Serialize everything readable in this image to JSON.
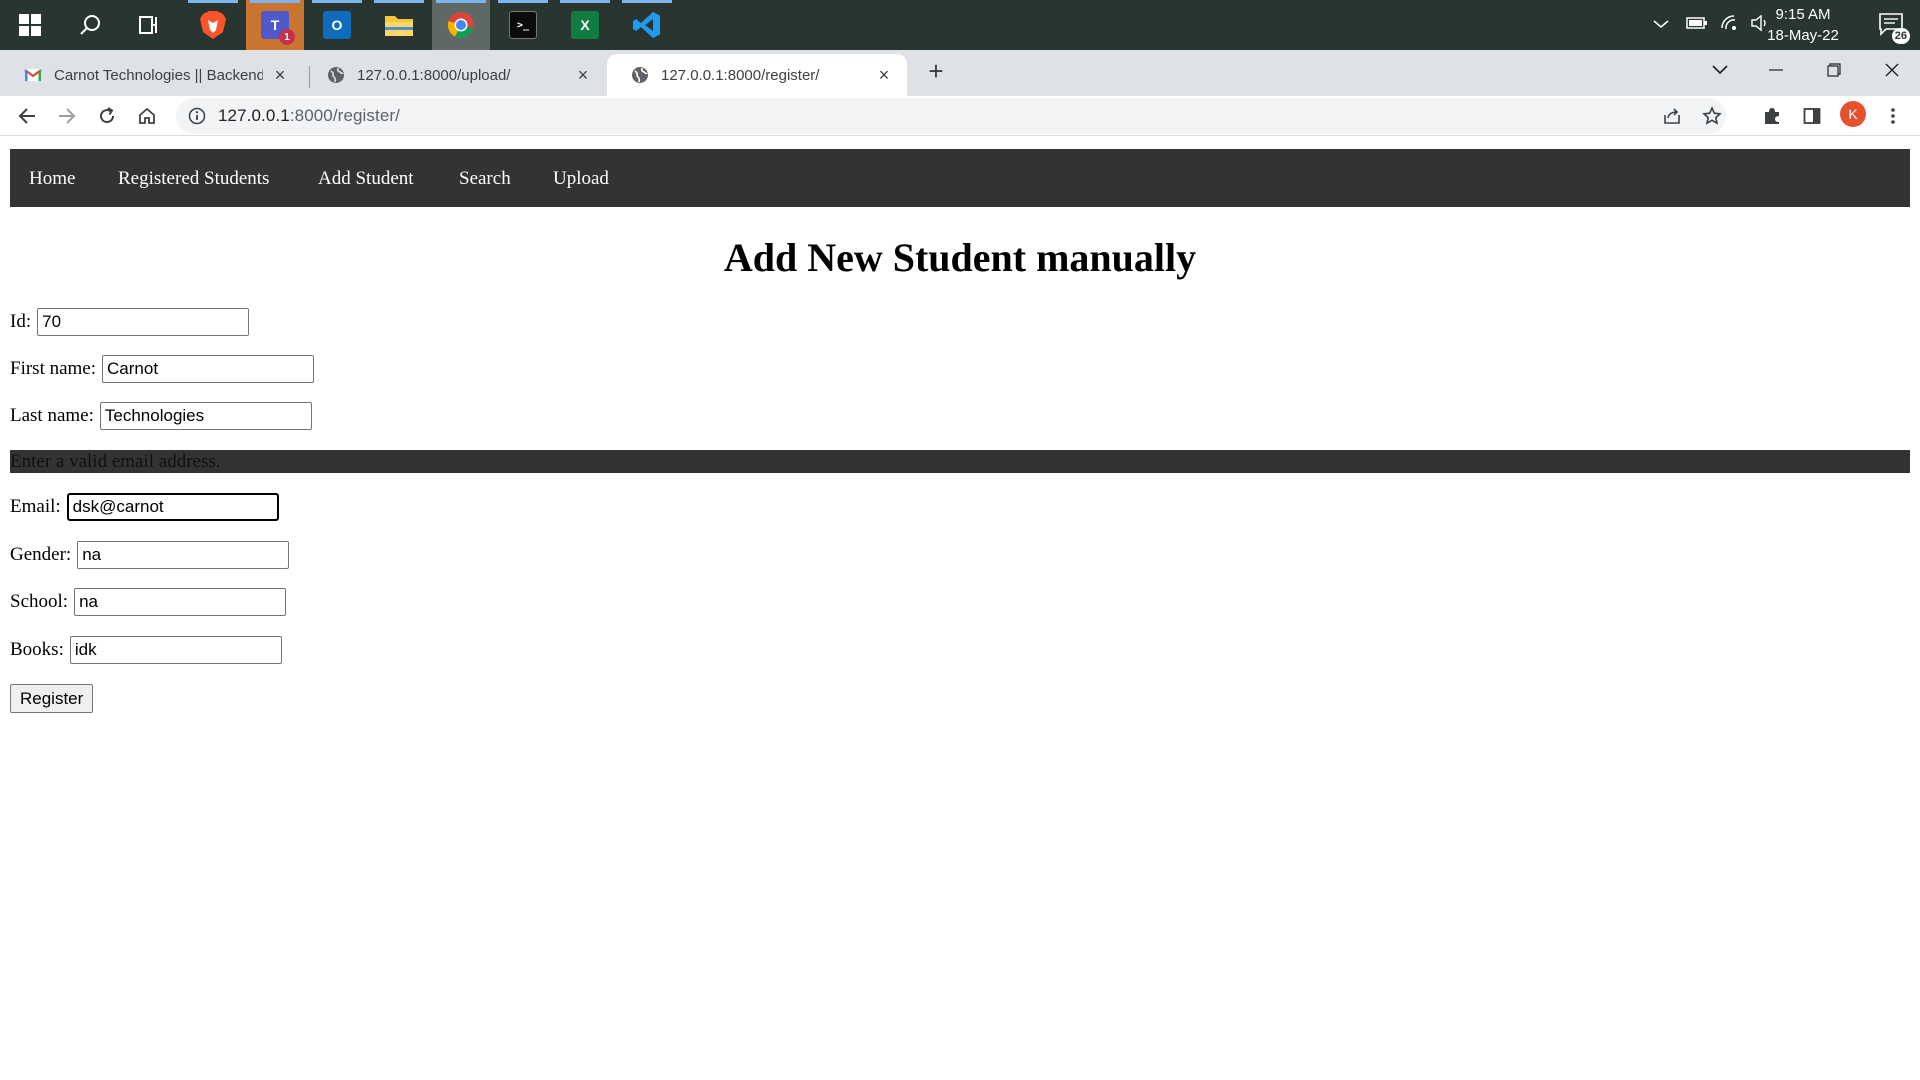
{
  "taskbar": {
    "apps": [
      {
        "name": "start"
      },
      {
        "name": "search"
      },
      {
        "name": "task-view"
      },
      {
        "name": "brave",
        "open": true
      },
      {
        "name": "teams",
        "open": true,
        "badge": "1",
        "letter": "T"
      },
      {
        "name": "outlook",
        "open": true,
        "letter": "O"
      },
      {
        "name": "file-explorer",
        "open": true
      },
      {
        "name": "chrome",
        "open": true
      },
      {
        "name": "terminal",
        "open": true,
        "letter": ">_"
      },
      {
        "name": "excel",
        "open": true,
        "letter": "X"
      },
      {
        "name": "vscode",
        "open": true
      }
    ],
    "time": "9:15 AM",
    "date": "18-May-22",
    "notification_count": "26"
  },
  "browser": {
    "tabs": [
      {
        "title": "Carnot Technologies || Backend D",
        "icon": "gmail-icon"
      },
      {
        "title": "127.0.0.1:8000/upload/",
        "icon": "globe-icon"
      },
      {
        "title": "127.0.0.1:8000/register/",
        "icon": "globe-icon",
        "active": true
      }
    ],
    "url_host": "127.0.0.1",
    "url_rest": ":8000/register/",
    "profile_initial": "K"
  },
  "page": {
    "nav": [
      "Home",
      "Registered Students",
      "Add Student",
      "Search",
      "Upload"
    ],
    "heading": "Add New Student manually",
    "fields": {
      "id": {
        "label": "Id:",
        "value": "70"
      },
      "first_name": {
        "label": "First name:",
        "value": "Carnot"
      },
      "last_name": {
        "label": "Last name:",
        "value": "Technologies"
      },
      "email": {
        "label": "Email:",
        "value": "dsk@carnot"
      },
      "gender": {
        "label": "Gender:",
        "value": "na"
      },
      "school": {
        "label": "School:",
        "value": "na"
      },
      "books": {
        "label": "Books:",
        "value": "idk"
      }
    },
    "email_error": "Enter a valid email address.",
    "submit_label": "Register"
  },
  "colors": {
    "navbar_bg": "#333333",
    "taskbar_bg": "#283530",
    "tabstrip_bg": "#dee1e6",
    "profile_bg": "#e8512e"
  }
}
